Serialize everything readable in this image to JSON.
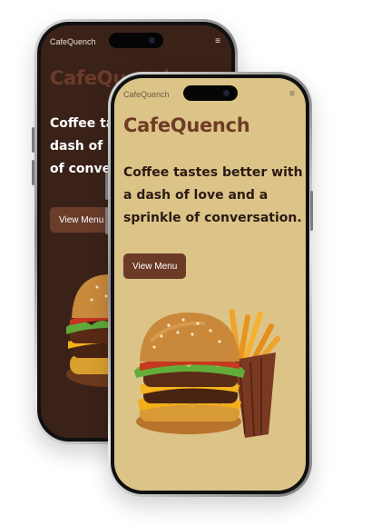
{
  "back_screen": {
    "topbar_title": "CafeQuench",
    "menu_icon": "hamburger-menu-icon",
    "brand": "CafeQuench",
    "tagline_lines": [
      "Coffee tas",
      "dash of lov",
      "of conver"
    ],
    "cta_label": "View Menu",
    "background": "#3b2218",
    "accent": "#6a3c2a"
  },
  "front_screen": {
    "topbar_title": "CafeQuench",
    "menu_icon": "hamburger-menu-icon",
    "brand": "CafeQuench",
    "tagline": "Coffee tastes better with a dash of love and a sprinkle of conversation.",
    "cta_label": "View Menu",
    "background": "#dcc488",
    "accent": "#6b3b28"
  },
  "images": {
    "hero_food": "burger-and-fries-image"
  }
}
